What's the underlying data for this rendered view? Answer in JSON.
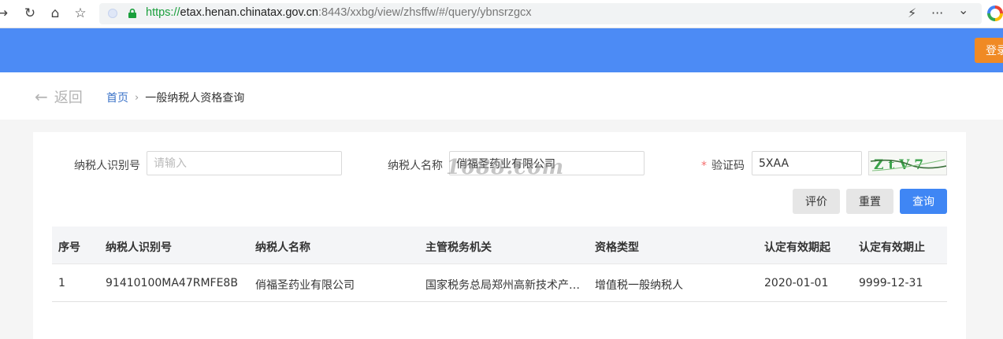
{
  "browser": {
    "url_secure": "https://",
    "url_host": "etax.henan.chinatax.gov.cn",
    "url_path": ":8443/xxbg/view/zhsffw/#/query/ybnsrzgcx",
    "back_glyph": "→",
    "refresh_glyph": "↻",
    "home_glyph": "⌂",
    "fav_glyph": "☆",
    "bolt_glyph": "⚡",
    "more_glyph": "···",
    "chevron_glyph": "⌄"
  },
  "header": {
    "login_label": "登录",
    "bg_color": "#4c8bf5",
    "login_color": "#f08a24"
  },
  "breadcrumb": {
    "back_arrow": "←",
    "back_label": "返回",
    "home": "首页",
    "separator": "›",
    "current": "一般纳税人资格查询"
  },
  "form": {
    "taxpayer_id_label": "纳税人识别号",
    "taxpayer_id_placeholder": "请输入",
    "taxpayer_id_value": "",
    "taxpayer_name_label": "纳税人名称",
    "taxpayer_name_value": "俏福圣药业有限公司",
    "captcha_required": "*",
    "captcha_label": "验证码",
    "captcha_value": "5XAA",
    "captcha_image_text": "Z t V 7",
    "watermark": "1688.com"
  },
  "buttons": {
    "evaluate": "评价",
    "reset": "重置",
    "query": "查询",
    "accent_color": "#3f86f4"
  },
  "table": {
    "columns": [
      "序号",
      "纳税人识别号",
      "纳税人名称",
      "主管税务机关",
      "资格类型",
      "认定有效期起",
      "认定有效期止"
    ],
    "rows": [
      [
        "1",
        "91410100MA47RMFE8B",
        "俏福圣药业有限公司",
        "国家税务总局郑州高新技术产…",
        "增值税一般纳税人",
        "2020-01-01",
        "9999-12-31"
      ]
    ]
  }
}
